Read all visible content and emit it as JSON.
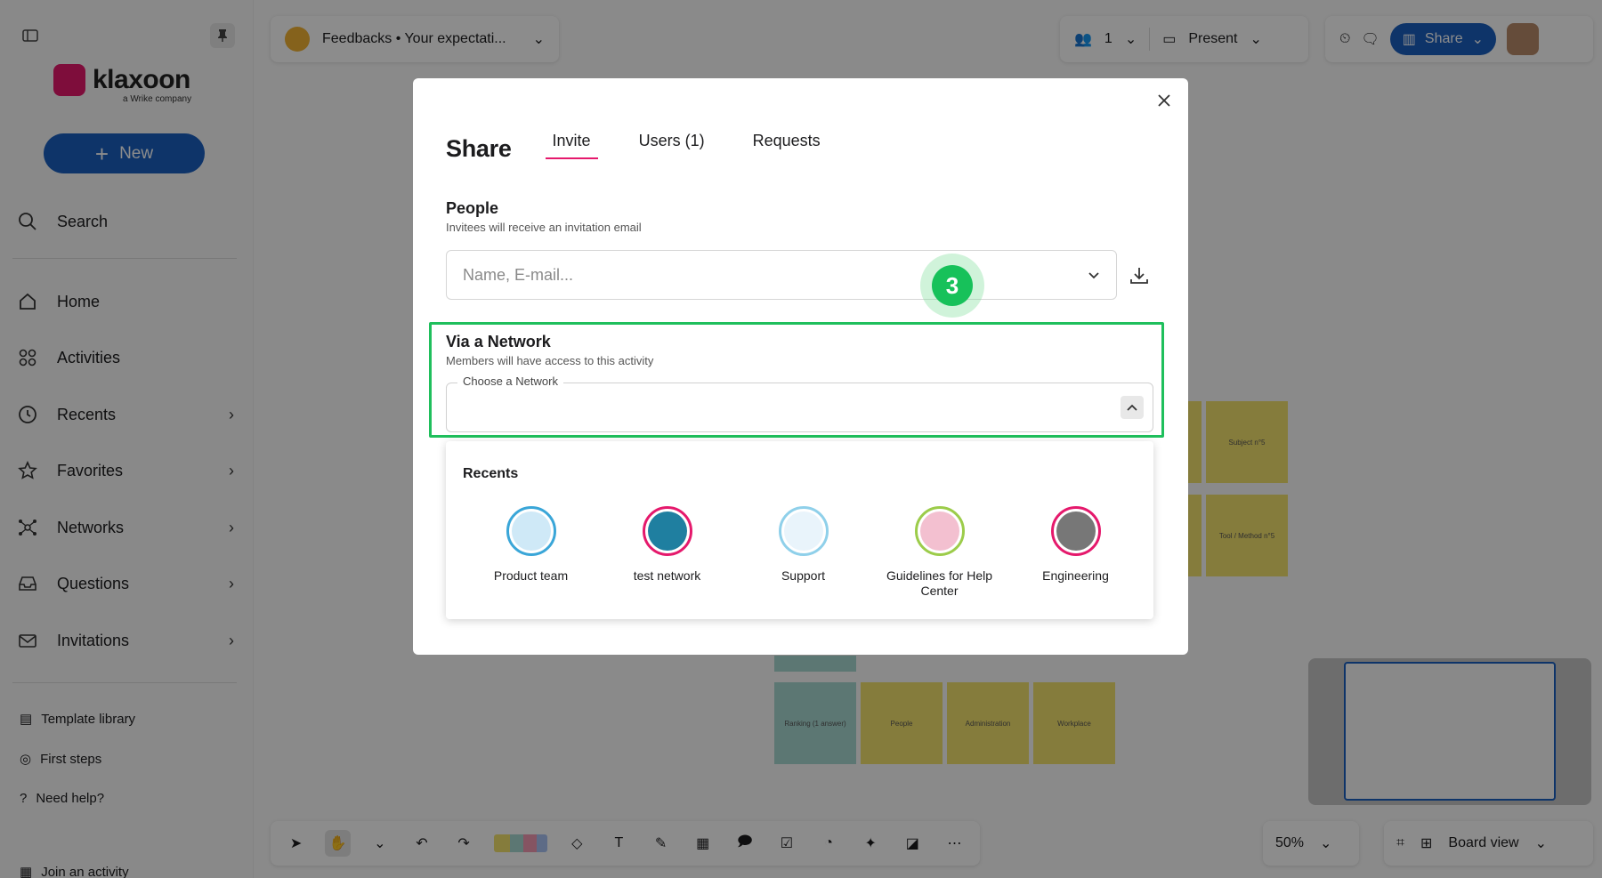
{
  "sidebar": {
    "logo_text": "klaxoon",
    "logo_sub": "a Wrike company",
    "new_label": "New",
    "search_label": "Search",
    "items": [
      {
        "label": "Home"
      },
      {
        "label": "Activities"
      },
      {
        "label": "Recents"
      },
      {
        "label": "Favorites"
      },
      {
        "label": "Networks"
      },
      {
        "label": "Questions"
      },
      {
        "label": "Invitations"
      }
    ],
    "bottom": {
      "template_library": "Template library",
      "first_steps": "First steps",
      "need_help": "Need help?",
      "join_activity": "Join an activity"
    }
  },
  "topbar": {
    "board_title": "Feedbacks • Your expectati...",
    "participants_count": "1",
    "present_label": "Present",
    "share_label": "Share"
  },
  "board": {
    "stickies": {
      "subject": "Subject n°5",
      "tool": "Tool / Method n°5",
      "ranking": "Ranking (1 answer)",
      "people": "People",
      "administration": "Administration",
      "workplace": "Workplace"
    }
  },
  "bottombar": {
    "zoom": "50%",
    "view_label": "Board view"
  },
  "modal": {
    "title": "Share",
    "tabs": [
      {
        "label": "Invite"
      },
      {
        "label": "Users (1)"
      },
      {
        "label": "Requests"
      }
    ],
    "people": {
      "title": "People",
      "subtitle": "Invitees will receive an invitation email",
      "placeholder": "Name, E-mail..."
    },
    "step_number": "3",
    "network": {
      "title": "Via a Network",
      "subtitle": "Members will have access to this activity",
      "field_label": "Choose a Network"
    },
    "dropdown": {
      "title": "Recents",
      "items": [
        {
          "label": "Product team",
          "ring": "#3aa6d8",
          "fill": "#cfe9f7"
        },
        {
          "label": "test network",
          "ring": "#e5196c",
          "fill": "#1f7fa0"
        },
        {
          "label": "Support",
          "ring": "#8fd0ea",
          "fill": "#e9f4fb"
        },
        {
          "label": "Guidelines for Help Center",
          "ring": "#9ccc4a",
          "fill": "#f3c0d0"
        },
        {
          "label": "Engineering",
          "ring": "#e5196c",
          "fill": "#777777"
        }
      ]
    }
  }
}
